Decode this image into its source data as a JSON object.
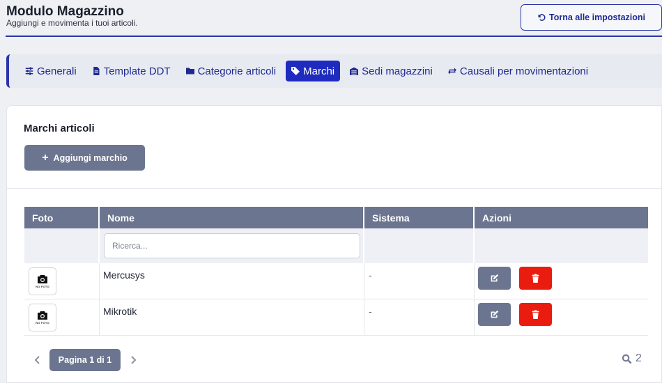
{
  "header": {
    "title": "Modulo Magazzino",
    "subtitle": "Aggiungi e movimenta i tuoi articoli.",
    "back_button": "Torna alle impostazioni",
    "back_icon": "undo-icon"
  },
  "tabs": [
    {
      "label": "Generali",
      "icon": "sliders-icon",
      "active": false
    },
    {
      "label": "Template DDT",
      "icon": "file-icon",
      "active": false
    },
    {
      "label": "Categorie articoli",
      "icon": "folder-icon",
      "active": false
    },
    {
      "label": "Marchi",
      "icon": "tag-icon",
      "active": true
    },
    {
      "label": "Sedi magazzini",
      "icon": "warehouse-icon",
      "active": false
    },
    {
      "label": "Causali per movimentazioni",
      "icon": "exchange-icon",
      "active": false
    }
  ],
  "card": {
    "title": "Marchi articoli",
    "add_button": "Aggiungi marchio"
  },
  "table": {
    "columns": [
      "Foto",
      "Nome",
      "Sistema",
      "Azioni"
    ],
    "search_placeholder": "Ricerca...",
    "rows": [
      {
        "foto_label": "NO FOTO",
        "nome": "Mercusys",
        "sistema": "-"
      },
      {
        "foto_label": "NO FOTO",
        "nome": "Mikrotik",
        "sistema": "-"
      }
    ]
  },
  "pagination": {
    "label": "Pagina 1 di 1",
    "total": "2"
  },
  "colors": {
    "primary": "#1f2bbf",
    "secondary": "#6c7590",
    "danger": "#ea1c0f",
    "background": "#eef0f4"
  }
}
